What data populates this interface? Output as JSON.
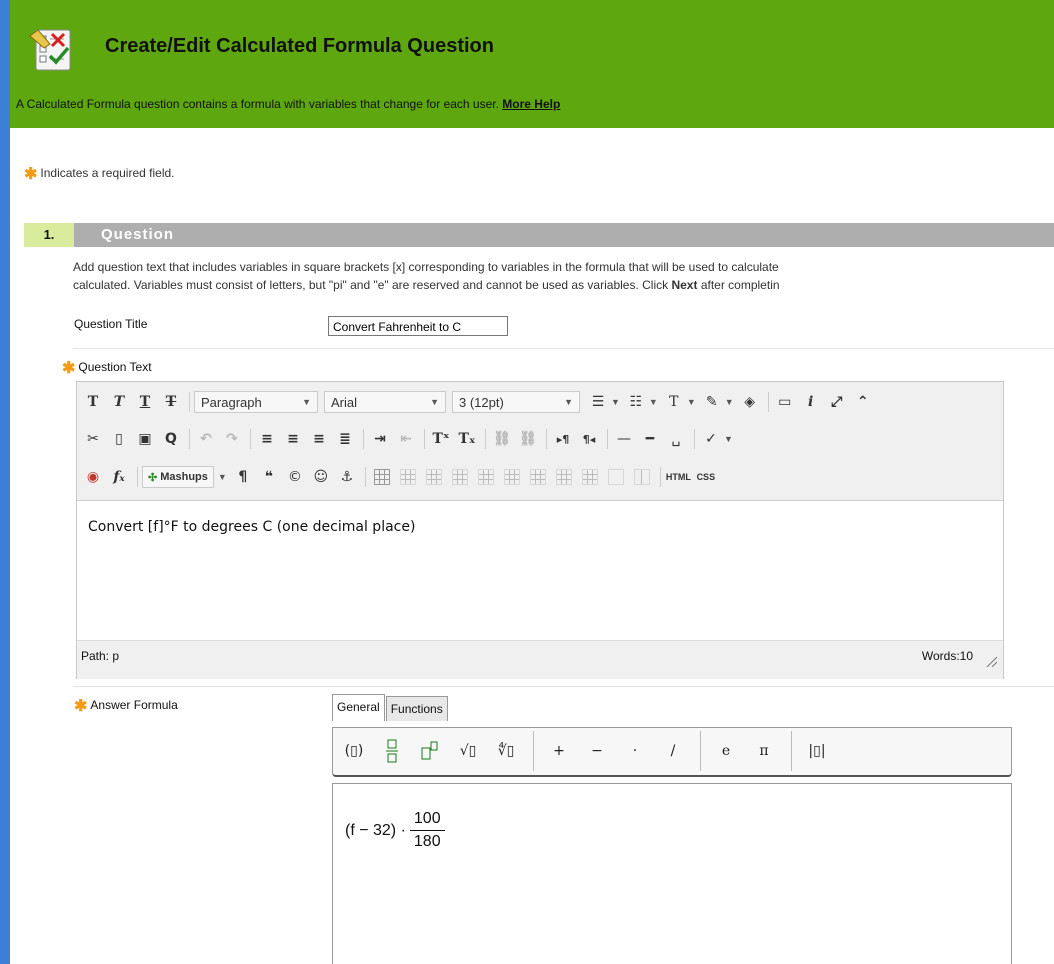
{
  "header": {
    "title": "Create/Edit Calculated Formula Question",
    "description": "A Calculated Formula question contains a formula with variables that change for each user.",
    "more_help": "More Help"
  },
  "required_note": "Indicates a required field.",
  "step": {
    "number": "1.",
    "title": "Question",
    "instructions_line1": "Add question text that includes variables in square brackets [x] corresponding to variables in the formula that will be used to calculate",
    "instructions_line2_pre": "calculated. Variables must consist of letters, but \"pi\" and \"e\" are reserved and cannot be used as variables. Click",
    "instructions_next": "Next",
    "instructions_line2_post": "after completin"
  },
  "fields": {
    "question_title_label": "Question Title",
    "question_title_value": "Convert Fahrenheit to C",
    "question_text_label": "Question Text",
    "answer_formula_label": "Answer Formula"
  },
  "editor": {
    "format_select": "Paragraph",
    "font_select": "Arial",
    "size_select": "3 (12pt)",
    "mashups_label": "Mashups",
    "html_label": "HTML",
    "css_label": "CSS",
    "content": "Convert [f]°F to degrees C (one decimal place)",
    "path_label": "Path:",
    "path_value": "p",
    "words_label": "Words:10"
  },
  "formula": {
    "tabs": [
      "General",
      "Functions"
    ],
    "active_tab": "General",
    "ops": [
      "+",
      "−",
      "·",
      "/"
    ],
    "consts": [
      "e",
      "π"
    ],
    "expression_prefix": "(f − 32) ·",
    "numerator": "100",
    "denominator": "180"
  },
  "colors": {
    "header_bg": "#5ea70e",
    "step_bar": "#aeaeae",
    "step_num_bg": "#d9ec9e",
    "required_star": "#f39c12",
    "frame_bg": "#3d7fd6"
  }
}
